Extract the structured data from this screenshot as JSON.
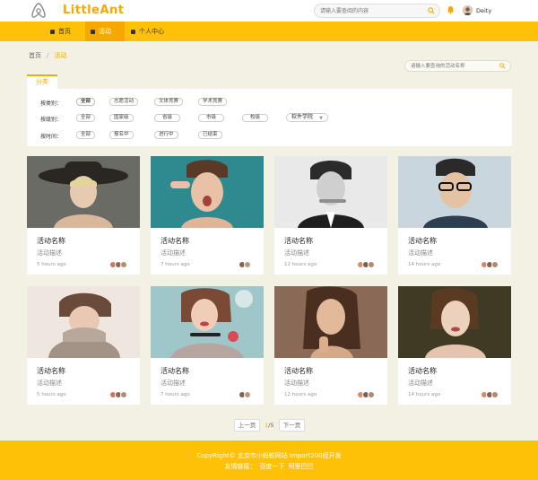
{
  "header": {
    "brand": "LittleAnt",
    "search_placeholder": "请输入要查阅的内容",
    "user_name": "Deity"
  },
  "nav": {
    "items": [
      {
        "label": "首页"
      },
      {
        "label": "活动"
      },
      {
        "label": "个人中心"
      }
    ],
    "active_index": 1
  },
  "breadcrumb": {
    "home": "首页",
    "sep": "/",
    "current": "活动"
  },
  "activity_search": {
    "placeholder": "请输入要查询的活动名称"
  },
  "category_tab": "分类",
  "filters": {
    "rows": [
      {
        "label": "按类别：",
        "options": [
          "全部",
          "志愿活动",
          "文体竞赛",
          "学术竞赛"
        ],
        "selected": 0
      },
      {
        "label": "按级别：",
        "options": [
          "全部",
          "国家级",
          "省级",
          "市级",
          "校级"
        ],
        "select_value": "软件学院"
      },
      {
        "label": "按时间：",
        "options": [
          "全部",
          "报名中",
          "进行中",
          "已结束"
        ]
      }
    ]
  },
  "cards": [
    {
      "title": "活动名称",
      "desc": "活动描述",
      "time": "5 hours ago"
    },
    {
      "title": "活动名称",
      "desc": "活动描述",
      "time": "7 hours ago"
    },
    {
      "title": "活动名称",
      "desc": "活动描述",
      "time": "12 hours ago"
    },
    {
      "title": "活动名称",
      "desc": "活动描述",
      "time": "14 hours ago"
    },
    {
      "title": "活动名称",
      "desc": "活动描述",
      "time": "5 hours ago"
    },
    {
      "title": "活动名称",
      "desc": "活动描述",
      "time": "7 hours ago"
    },
    {
      "title": "活动名称",
      "desc": "活动描述",
      "time": "12 hours ago"
    },
    {
      "title": "活动名称",
      "desc": "活动描述",
      "time": "14 hours ago"
    }
  ],
  "pagination": {
    "prev": "上一页",
    "current": "1",
    "total": "/5",
    "next": "下一页"
  },
  "footer": {
    "copyright": "CopyRight© 北京市小蚂蚁网站 Import200组开发",
    "links_label": "友情链接：",
    "links": [
      "百度一下",
      "阿里巴巴"
    ]
  },
  "colors": {
    "accent": "#ffc107",
    "accent_dark": "#f7a800",
    "background": "#f3f0e4"
  }
}
